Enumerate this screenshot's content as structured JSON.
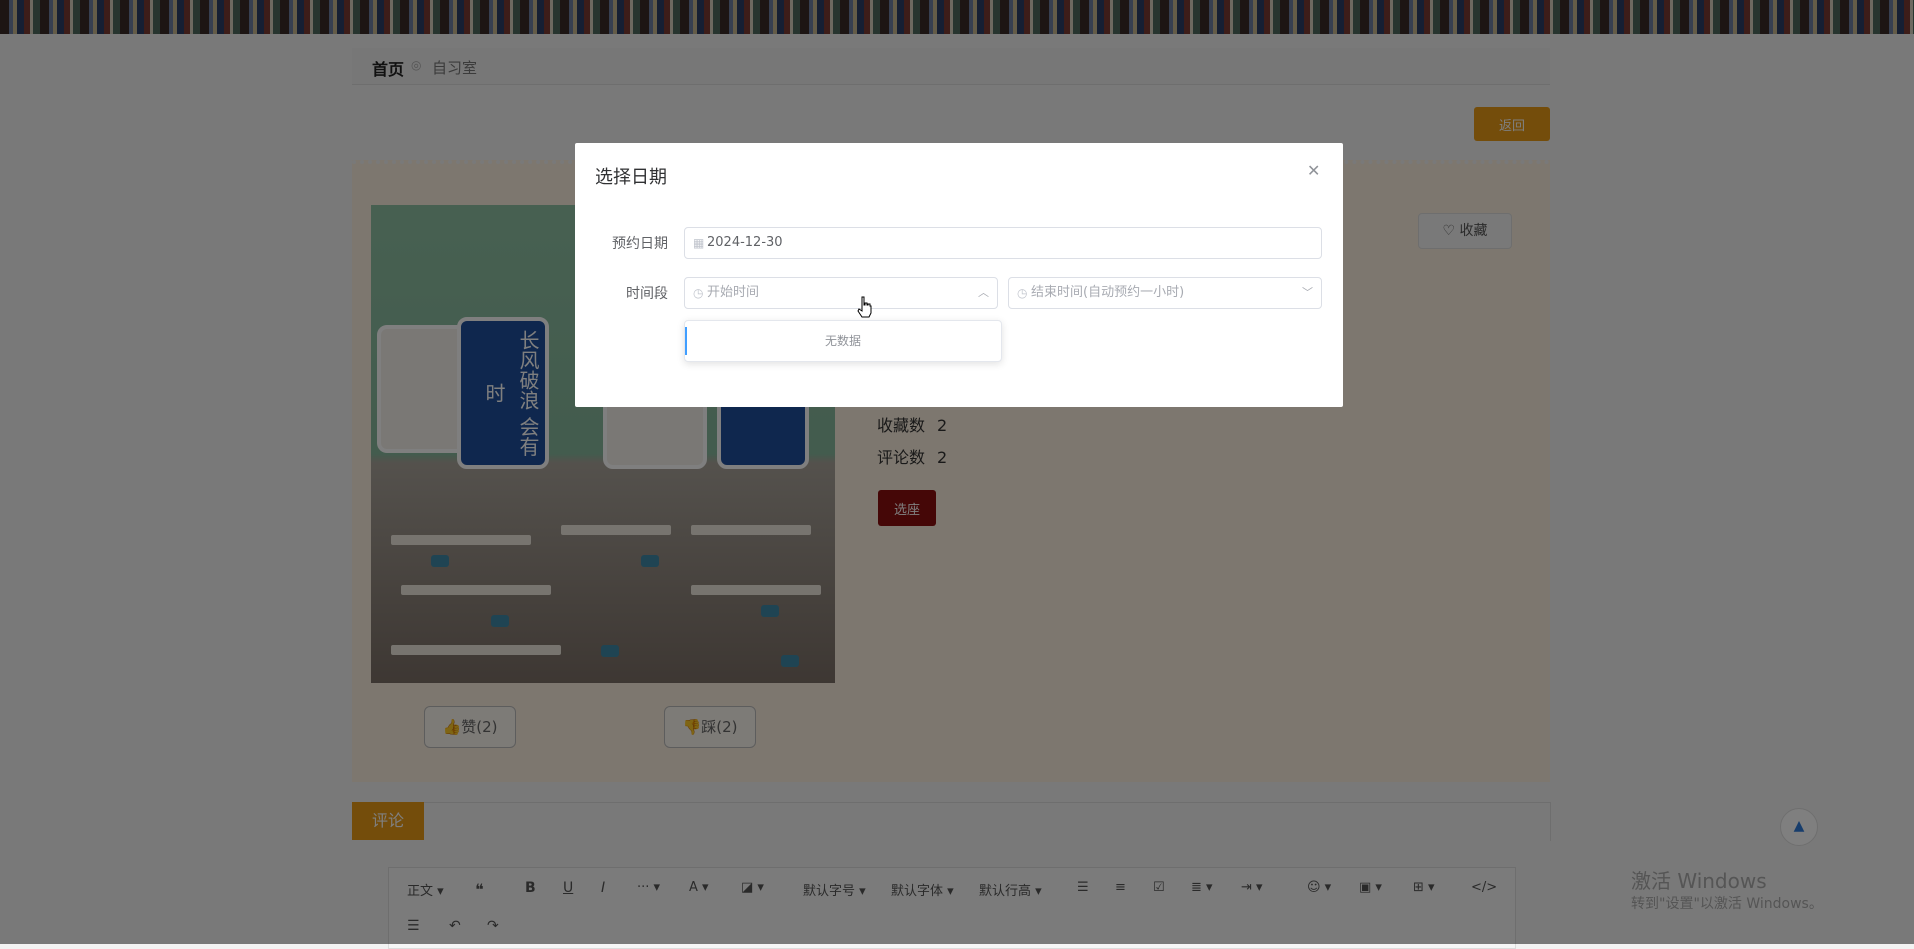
{
  "breadcrumb": {
    "home": "首页",
    "separator": "◎",
    "current": "自习室"
  },
  "back_button": "返回",
  "room": {
    "poster_texts": [
      "长风破浪",
      "会有时"
    ],
    "favorite_button": "收藏",
    "stats": [
      {
        "label": "收藏数",
        "value": "2"
      },
      {
        "label": "评论数",
        "value": "2"
      }
    ],
    "select_button": "选座",
    "like_button": "赞(2)",
    "dislike_button": "踩(2)"
  },
  "comments": {
    "tab": "评论",
    "toolbar": {
      "paragraph": "正文",
      "font_size": "默认字号",
      "font_family": "默认字体",
      "line_height": "默认行高"
    }
  },
  "back_to_top_icon": "up-arrow-icon",
  "watermark": {
    "title": "激活 Windows",
    "subtitle": "转到\"设置\"以激活 Windows。"
  },
  "dialog": {
    "title": "选择日期",
    "date_label": "预约日期",
    "date_value": "2024-12-30",
    "time_label": "时间段",
    "start_placeholder": "开始时间",
    "end_placeholder": "结束时间(自动预约一小时)",
    "dropdown_empty": "无数据"
  },
  "colors": {
    "accent_orange": "#e89a17",
    "primary_red": "#8a0f0f",
    "link_blue": "#409eff"
  }
}
